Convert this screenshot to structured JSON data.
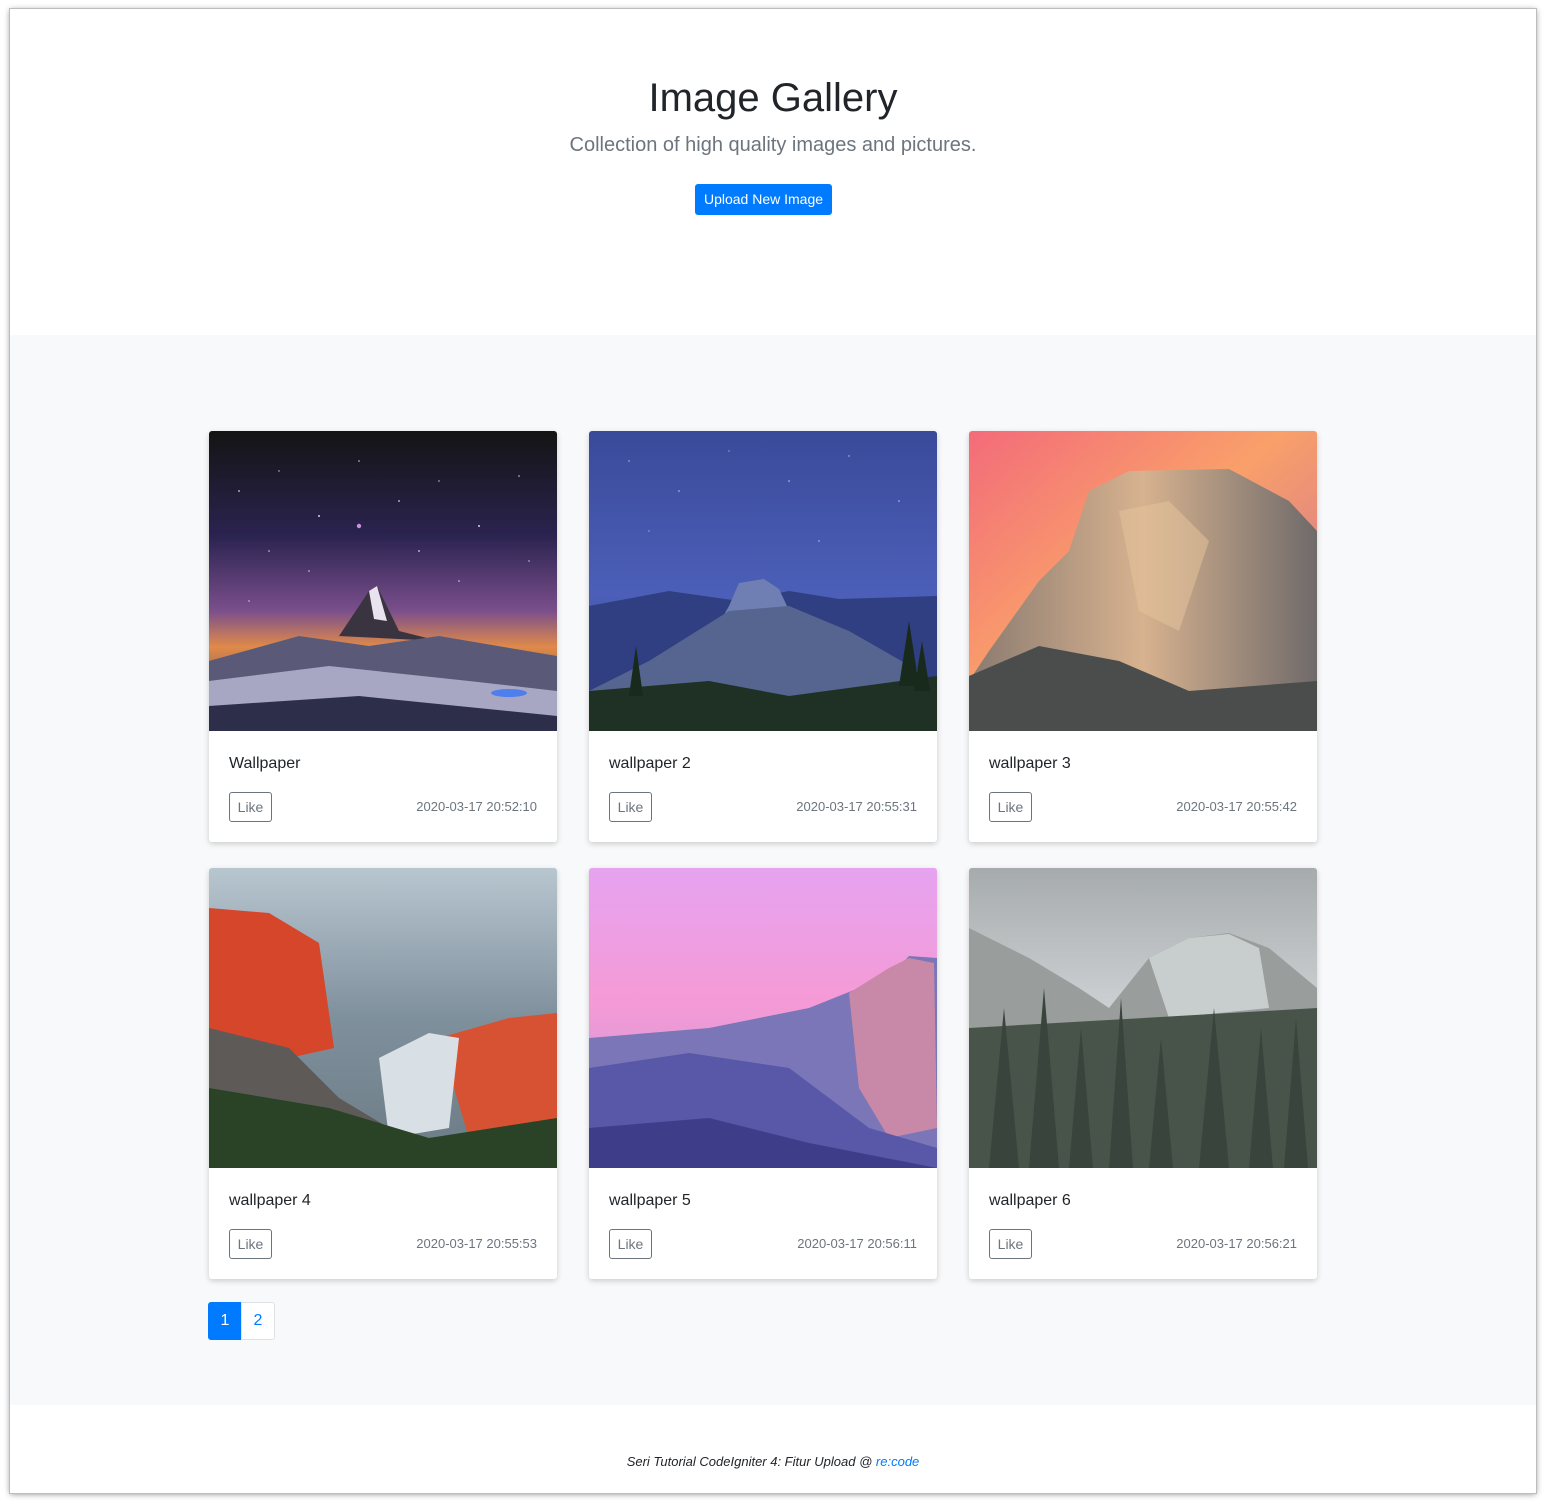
{
  "hero": {
    "title": "Image Gallery",
    "subtitle": "Collection of high quality images and pictures.",
    "upload_label": "Upload New Image"
  },
  "cards": [
    {
      "title": "Wallpaper",
      "like_label": "Like",
      "date": "2020-03-17 20:52:10",
      "image": "starry-matterhorn-night"
    },
    {
      "title": "wallpaper 2",
      "like_label": "Like",
      "date": "2020-03-17 20:55:31",
      "image": "half-dome-blue-dusk"
    },
    {
      "title": "wallpaper 3",
      "like_label": "Like",
      "date": "2020-03-17 20:55:42",
      "image": "granite-cliff-pink-sunset"
    },
    {
      "title": "wallpaper 4",
      "like_label": "Like",
      "date": "2020-03-17 20:55:53",
      "image": "el-capitan-red-glow"
    },
    {
      "title": "wallpaper 5",
      "like_label": "Like",
      "date": "2020-03-17 20:56:11",
      "image": "yosemite-purple-sky"
    },
    {
      "title": "wallpaper 6",
      "like_label": "Like",
      "date": "2020-03-17 20:56:21",
      "image": "misty-forest-valley"
    }
  ],
  "pagination": {
    "pages": [
      "1",
      "2"
    ],
    "active": "1"
  },
  "footer": {
    "text": "Seri Tutorial CodeIgniter 4: Fitur Upload @ ",
    "link_label": "re:code"
  },
  "colors": {
    "primary": "#007bff",
    "muted": "#6c757d",
    "album_bg": "#f8f9fa"
  }
}
